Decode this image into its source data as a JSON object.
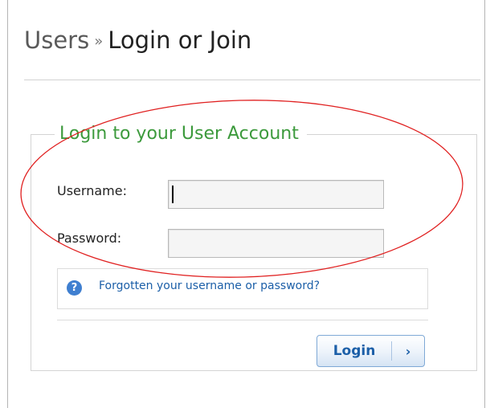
{
  "header": {
    "breadcrumb_parent": "Users",
    "breadcrumb_separator": "»",
    "current_page": "Login or Join"
  },
  "login_form": {
    "legend": "Login to your User Account",
    "username_label": "Username:",
    "username_value": "",
    "password_label": "Password:",
    "password_value": "",
    "help_link": "Forgotten your username or password?",
    "submit_label": "Login",
    "submit_chevron": "›"
  },
  "help_icon_glyph": "?",
  "colors": {
    "legend_green": "#3c9a3c",
    "link_blue": "#1c5fa8",
    "annotation_red": "#e02020"
  }
}
